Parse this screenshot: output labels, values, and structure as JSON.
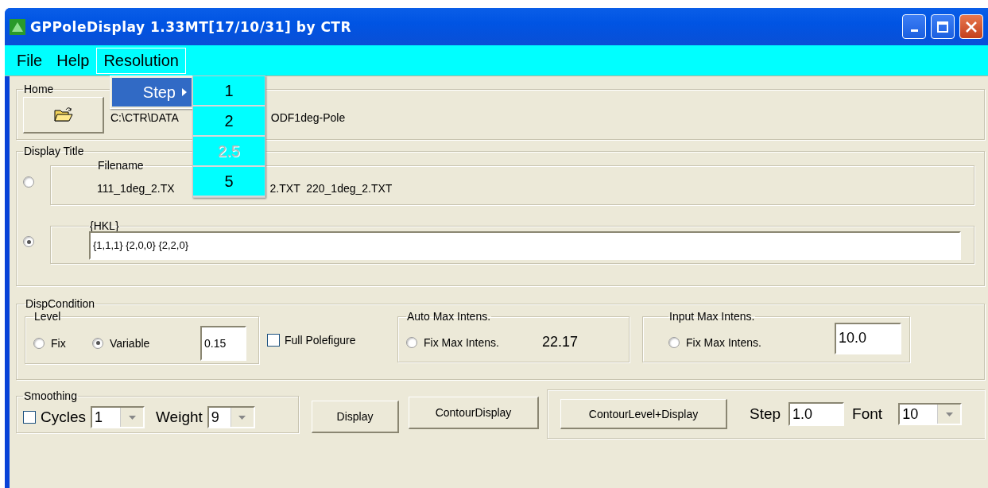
{
  "window": {
    "title": "GPPoleDisplay 1.33MT[17/10/31] by CTR"
  },
  "menu_bar": [
    {
      "label": "File",
      "selected": false
    },
    {
      "label": "Help",
      "selected": false
    },
    {
      "label": "Resolution",
      "selected": true
    }
  ],
  "open_menu": {
    "items": [
      {
        "label": "Step",
        "selected": true,
        "submenu": [
          {
            "label": "1",
            "disabled": false
          },
          {
            "label": "2",
            "disabled": false
          },
          {
            "label": "2.5",
            "disabled": true
          },
          {
            "label": "5",
            "disabled": false
          }
        ]
      }
    ]
  },
  "home": {
    "title": "Home",
    "path_parts": [
      "C:\\CTR\\DATA",
      "ODF1deg-Pole"
    ]
  },
  "display_title": {
    "title": "Display Title",
    "options": [
      {
        "kind": "filename",
        "label": "Filename",
        "selected": false,
        "text_parts": [
          "111_1deg_2.TX",
          "2.TXT  220_1deg_2.TXT"
        ]
      },
      {
        "kind": "hkl",
        "label": "{HKL}",
        "selected": true,
        "value": "{1,1,1} {2,0,0} {2,2,0}"
      }
    ]
  },
  "disp_condition": {
    "title": "DispCondition",
    "level": {
      "title": "Level",
      "options": [
        {
          "label": "Fix",
          "selected": false
        },
        {
          "label": "Variable",
          "selected": true
        }
      ],
      "value": "0.15"
    },
    "full_polefigure": {
      "label": "Full Polefigure",
      "checked": false
    },
    "auto_max": {
      "title": "Auto Max Intens.",
      "radio": {
        "label": "Fix Max Intens.",
        "selected": false
      },
      "reading": "22.17"
    },
    "input_max": {
      "title": "Input Max Intens.",
      "radio": {
        "label": "Fix Max Intens.",
        "selected": false
      },
      "value": "10.0"
    }
  },
  "smoothing": {
    "title": "Smoothing",
    "cycles": {
      "label": "Cycles",
      "checked": false,
      "value": "1"
    },
    "weight": {
      "label": "Weight",
      "value": "9"
    }
  },
  "buttons": [
    "Display",
    "ContourDisplay"
  ],
  "contour": {
    "button": "ContourLevel+Display",
    "step_label": "Step",
    "step_value": "1.0",
    "font_label": "Font",
    "font_value": "10"
  }
}
